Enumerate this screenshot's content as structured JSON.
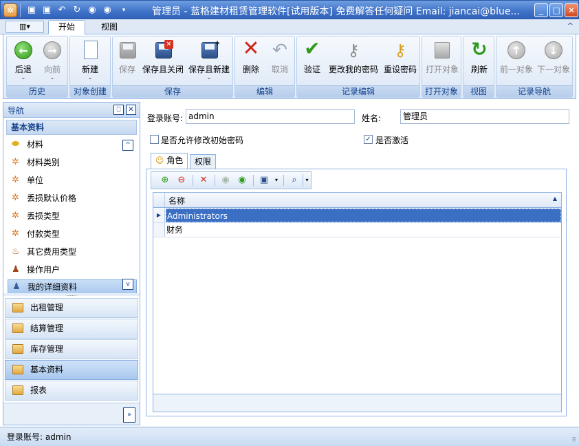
{
  "window": {
    "title": "管理员 - 蓝格建材租赁管理软件[试用版本] 免费解答任何疑问 Email: jiancai@blue...",
    "minimize": "_",
    "maximize": "□",
    "close": "✕"
  },
  "quick_access": [
    "save-icon",
    "save-close-icon",
    "undo-icon",
    "refresh-icon",
    "up-icon",
    "down-icon",
    "customize-icon"
  ],
  "ribbon": {
    "app_menu": "▥▾",
    "tabs": [
      {
        "label": "开始",
        "active": true
      },
      {
        "label": "视图",
        "active": false
      }
    ],
    "collapse": "^",
    "groups": [
      {
        "label": "历史",
        "buttons": [
          {
            "label": "后退",
            "icon": "back-arrow-icon",
            "enabled": true
          },
          {
            "label": "向前",
            "icon": "forward-arrow-icon",
            "enabled": false
          }
        ]
      },
      {
        "label": "对象创建",
        "buttons": [
          {
            "label": "新建",
            "icon": "new-document-icon",
            "enabled": true
          }
        ]
      },
      {
        "label": "保存",
        "buttons": [
          {
            "label": "保存",
            "icon": "save-icon",
            "enabled": false
          },
          {
            "label": "保存且关闭",
            "icon": "save-close-icon",
            "enabled": true
          },
          {
            "label": "保存且新建",
            "icon": "save-new-icon",
            "enabled": true
          }
        ]
      },
      {
        "label": "编辑",
        "buttons": [
          {
            "label": "删除",
            "icon": "delete-icon",
            "enabled": true
          },
          {
            "label": "取消",
            "icon": "undo-icon",
            "enabled": false
          }
        ]
      },
      {
        "label": "记录编辑",
        "buttons": [
          {
            "label": "验证",
            "icon": "check-icon",
            "enabled": true
          },
          {
            "label": "更改我的密码",
            "icon": "keys-icon",
            "enabled": true
          },
          {
            "label": "重设密码",
            "icon": "reset-key-icon",
            "enabled": true
          }
        ]
      },
      {
        "label": "打开对象",
        "buttons": [
          {
            "label": "打开对象",
            "icon": "open-object-icon",
            "enabled": false
          }
        ]
      },
      {
        "label": "视图",
        "buttons": [
          {
            "label": "刷新",
            "icon": "refresh-icon",
            "enabled": true
          }
        ]
      },
      {
        "label": "记录导航",
        "buttons": [
          {
            "label": "前一对象",
            "icon": "previous-object-icon",
            "enabled": false
          },
          {
            "label": "下一对象",
            "icon": "next-object-icon",
            "enabled": false
          }
        ]
      }
    ]
  },
  "nav": {
    "title": "导航",
    "pin": "⎕",
    "close": "✕",
    "category": "基本资料",
    "items": [
      {
        "label": "材料",
        "icon": "material-icon"
      },
      {
        "label": "材料类别",
        "icon": "gear-icon"
      },
      {
        "label": "单位",
        "icon": "gear-icon"
      },
      {
        "label": "丢损默认价格",
        "icon": "gear-icon"
      },
      {
        "label": "丢损类型",
        "icon": "gear-icon"
      },
      {
        "label": "付款类型",
        "icon": "gear-icon"
      },
      {
        "label": "其它费用类型",
        "icon": "money-bag-icon"
      },
      {
        "label": "操作用户",
        "icon": "users-icon"
      },
      {
        "label": "我的详细资料",
        "icon": "user-icon",
        "selected": true
      }
    ],
    "panes": [
      {
        "label": "出租管理",
        "selected": false
      },
      {
        "label": "结算管理",
        "selected": false
      },
      {
        "label": "库存管理",
        "selected": false
      },
      {
        "label": "基本资料",
        "selected": true
      },
      {
        "label": "报表",
        "selected": false
      }
    ],
    "split_handle": "......",
    "scroll_up": "^",
    "scroll_down": "v",
    "more": "»"
  },
  "form": {
    "login_label": "登录账号:",
    "login_value": "admin",
    "name_label": "姓名:",
    "name_value": "管理员",
    "allow_change_pwd_label": "是否允许修改初始密码",
    "allow_change_pwd": false,
    "active_label": "是否激活",
    "active": true,
    "tabs": [
      {
        "label": "角色",
        "icon": "role-icon",
        "active": true
      },
      {
        "label": "权限",
        "active": false
      }
    ],
    "grid": {
      "columns": [
        "名称"
      ],
      "rows": [
        {
          "name": "Administrators",
          "selected": true
        },
        {
          "name": "财务",
          "selected": false
        }
      ]
    }
  },
  "status": {
    "text": "登录账号: admin"
  }
}
